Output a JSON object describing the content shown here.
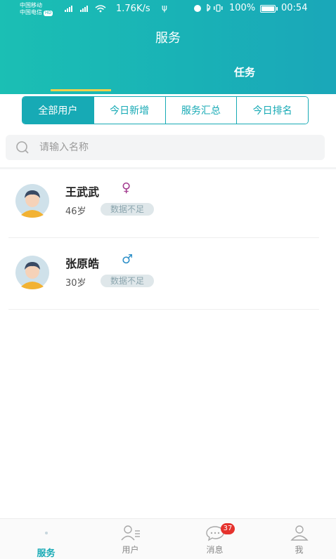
{
  "status_bar": {
    "carrier1": "中国移动",
    "carrier2": "中国电信",
    "hd": "HD",
    "net_speed": "1.76K/s",
    "battery_pct": "100%",
    "time": "00:54"
  },
  "header": {
    "title": "服务",
    "tab_task": "任务",
    "accent": "#17aab5",
    "underline_color": "#f3d04a"
  },
  "segments": [
    {
      "label": "全部用户",
      "active": true
    },
    {
      "label": "今日新增",
      "active": false
    },
    {
      "label": "服务汇总",
      "active": false
    },
    {
      "label": "今日排名",
      "active": false
    }
  ],
  "search": {
    "placeholder": "请输入名称",
    "icon": "search-icon"
  },
  "users": [
    {
      "name": "王武武",
      "gender": "female",
      "gender_symbol": "♀",
      "gender_color": "#a23a8f",
      "age": "46岁",
      "status": "数据不足"
    },
    {
      "name": "张原皓",
      "gender": "male",
      "gender_symbol": "♂",
      "gender_color": "#2d8fc8",
      "age": "30岁",
      "status": "数据不足"
    }
  ],
  "bottom_nav": [
    {
      "label": "服务",
      "icon": "service-icon",
      "active": true
    },
    {
      "label": "用户",
      "icon": "user-list-icon",
      "active": false
    },
    {
      "label": "消息",
      "icon": "message-icon",
      "active": false,
      "badge": "37"
    },
    {
      "label": "我",
      "icon": "profile-icon",
      "active": false
    }
  ]
}
